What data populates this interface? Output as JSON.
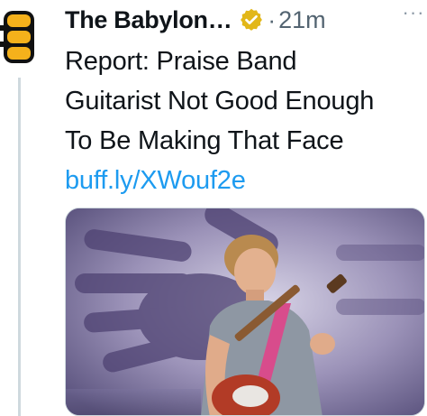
{
  "tweet": {
    "author_name": "The Babylon…",
    "separator": "·",
    "timestamp": "21m",
    "text_lines": [
      "Report: Praise Band",
      "Guitarist Not Good Enough",
      "To Be Making That Face"
    ],
    "link": "buff.ly/XWouf2e",
    "more_glyph": "···"
  },
  "colors": {
    "link": "#1d9bf0",
    "muted": "#536471",
    "verified_badge": "#e2b719",
    "avatar_yellow": "#f5b11b",
    "avatar_black": "#111111"
  },
  "icons": {
    "avatar": "babylon-bee-logo",
    "verified": "gold-verified-badge-icon",
    "more": "more-options-icon",
    "media": "photo-guitarist-with-hand-shadow"
  }
}
